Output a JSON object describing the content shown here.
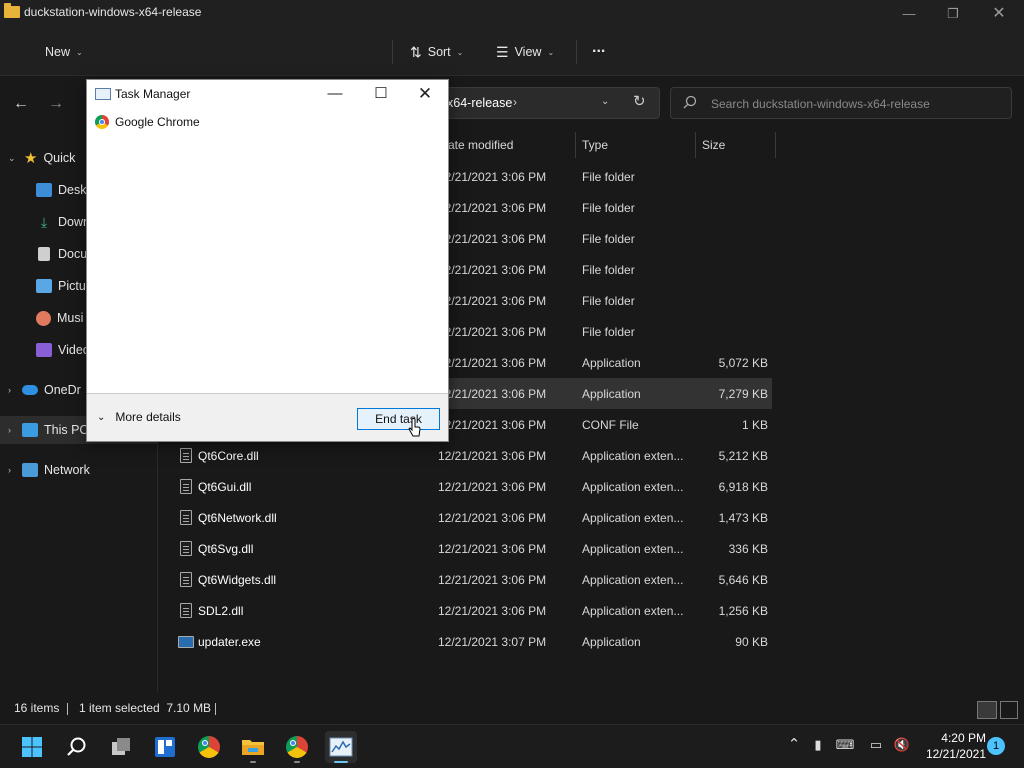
{
  "explorer": {
    "window_title": "duckstation-windows-x64-release",
    "toolbar": {
      "new_label": "New",
      "sort_label": "Sort",
      "view_label": "View",
      "more_label": "..."
    },
    "address": {
      "path_text": "x64-release"
    },
    "search": {
      "placeholder": "Search duckstation-windows-x64-release"
    },
    "nav": [
      {
        "label": "Quick",
        "icon": "star-icon"
      },
      {
        "label": "Deskt",
        "icon": "desktop-icon"
      },
      {
        "label": "Down",
        "icon": "download-icon"
      },
      {
        "label": "Docu",
        "icon": "document-icon"
      },
      {
        "label": "Pictu",
        "icon": "pictures-icon"
      },
      {
        "label": "Musi",
        "icon": "music-icon"
      },
      {
        "label": "Video",
        "icon": "video-icon"
      },
      {
        "label": "OneDr",
        "icon": "cloud-icon"
      },
      {
        "label": "This PC",
        "icon": "computer-icon"
      },
      {
        "label": "Network",
        "icon": "network-icon"
      }
    ],
    "columns": {
      "date": "ate modified",
      "type": "Type",
      "size": "Size"
    },
    "files": [
      {
        "name": "",
        "date": "12/21/2021 3:06 PM",
        "type": "File folder",
        "size": ""
      },
      {
        "name": "",
        "date": "12/21/2021 3:06 PM",
        "type": "File folder",
        "size": ""
      },
      {
        "name": "",
        "date": "12/21/2021 3:06 PM",
        "type": "File folder",
        "size": ""
      },
      {
        "name": "",
        "date": "12/21/2021 3:06 PM",
        "type": "File folder",
        "size": ""
      },
      {
        "name": "",
        "date": "12/21/2021 3:06 PM",
        "type": "File folder",
        "size": ""
      },
      {
        "name": "",
        "date": "12/21/2021 3:06 PM",
        "type": "File folder",
        "size": ""
      },
      {
        "name": "",
        "date": "12/21/2021 3:06 PM",
        "type": "Application",
        "size": "5,072 KB"
      },
      {
        "name": "",
        "date": "12/21/2021 3:06 PM",
        "type": "Application",
        "size": "7,279 KB"
      },
      {
        "name": "",
        "date": "12/21/2021 3:06 PM",
        "type": "CONF File",
        "size": "1 KB"
      },
      {
        "name": "Qt6Core.dll",
        "date": "12/21/2021 3:06 PM",
        "type": "Application exten...",
        "size": "5,212 KB"
      },
      {
        "name": "Qt6Gui.dll",
        "date": "12/21/2021 3:06 PM",
        "type": "Application exten...",
        "size": "6,918 KB"
      },
      {
        "name": "Qt6Network.dll",
        "date": "12/21/2021 3:06 PM",
        "type": "Application exten...",
        "size": "1,473 KB"
      },
      {
        "name": "Qt6Svg.dll",
        "date": "12/21/2021 3:06 PM",
        "type": "Application exten...",
        "size": "336 KB"
      },
      {
        "name": "Qt6Widgets.dll",
        "date": "12/21/2021 3:06 PM",
        "type": "Application exten...",
        "size": "5,646 KB"
      },
      {
        "name": "SDL2.dll",
        "date": "12/21/2021 3:06 PM",
        "type": "Application exten...",
        "size": "1,256 KB"
      },
      {
        "name": "updater.exe",
        "date": "12/21/2021 3:07 PM",
        "type": "Application",
        "size": "90 KB"
      }
    ],
    "status": {
      "items": "16 items",
      "selected": "1 item selected  7.10 MB"
    }
  },
  "taskmgr": {
    "title": "Task Manager",
    "app_name": "Google Chrome",
    "more_details": "More details",
    "end_task": "End task"
  },
  "taskbar": {
    "time": "4:20 PM",
    "date": "12/21/2021",
    "notification_count": "1"
  },
  "colors": {
    "accent": "#0078d7",
    "folder": "#e8b33a",
    "taskbar_indicator": "#6cc4f0"
  }
}
